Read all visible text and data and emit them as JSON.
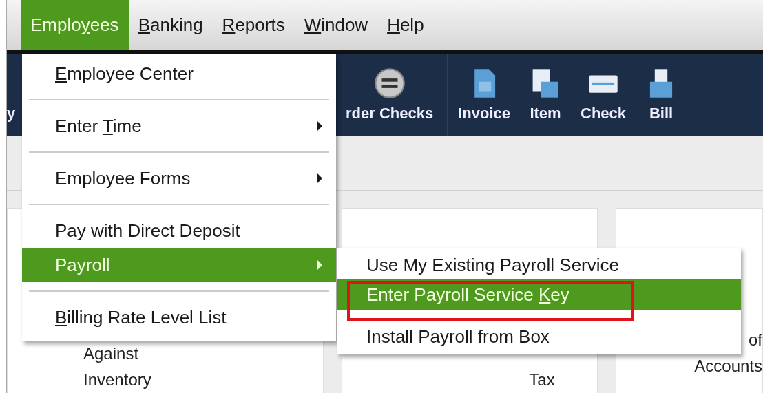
{
  "menubar": [
    {
      "pre": "Emplo",
      "key": "y",
      "post": "ees",
      "selected": true
    },
    {
      "key": "B",
      "post": "anking",
      "selected": false
    },
    {
      "key": "R",
      "post": "eports",
      "selected": false
    },
    {
      "key": "W",
      "post": "indow",
      "selected": false
    },
    {
      "key": "H",
      "post": "elp",
      "selected": false
    }
  ],
  "toolbar": [
    {
      "label": "y",
      "kind": "cut"
    },
    {
      "label": "rder Checks",
      "kind": "circle"
    },
    {
      "label": "Invoice",
      "kind": "invoice"
    },
    {
      "label": "Item",
      "kind": "item"
    },
    {
      "label": "Check",
      "kind": "check"
    },
    {
      "label": "Bill",
      "kind": "bill"
    }
  ],
  "tiles": [
    {
      "lines": [
        "Against",
        "Inventory"
      ]
    },
    {
      "lines": [
        "Tax"
      ]
    },
    {
      "lines": [
        "of",
        "Accounts"
      ]
    }
  ],
  "dropdown": [
    {
      "key": "E",
      "post": "mployee Center",
      "submenu": false,
      "selected": false
    },
    {
      "pre": "Enter ",
      "key": "T",
      "post": "ime",
      "submenu": true,
      "selected": false
    },
    {
      "pre": "Employee Forms",
      "submenu": true,
      "selected": false
    },
    {
      "pre": "Pay with Direct Deposit",
      "submenu": false,
      "selected": false
    },
    {
      "pre": "Payroll",
      "submenu": true,
      "selected": true
    },
    {
      "key": "B",
      "post": "illing Rate Level List",
      "submenu": false,
      "selected": false
    }
  ],
  "submenu": {
    "callout_on_selected": true,
    "items": [
      {
        "pre": "Use My Existing Payroll Service",
        "selected": false
      },
      {
        "pre": "Enter Payroll Service ",
        "key": "K",
        "post": "ey",
        "selected": true
      },
      {
        "pre": "Install Payroll from Box",
        "selected": false
      }
    ]
  }
}
